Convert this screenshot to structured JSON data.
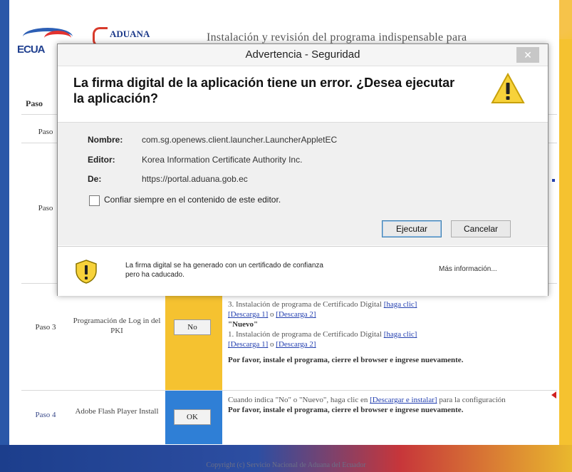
{
  "page": {
    "logo_ecua": "ECUA",
    "logo_aduana": "ADUANA",
    "title": "Instalación y revisión del programa indispensable para",
    "table_header_paso": "Paso",
    "rows": [
      {
        "paso": "Paso"
      },
      {
        "paso": "Paso"
      },
      {
        "paso": "Paso 3",
        "name": "Programación de Log in del PKI",
        "status": "No",
        "lines": [
          {
            "text": "3. Instalación de programa de Certificado Digital ",
            "link": "[haga clic]"
          },
          {
            "link": "[Descarga 1]",
            "text": " o ",
            "link2": "[Descarga 2]"
          },
          {
            "text": "\"Nuevo\""
          },
          {
            "text": "1. Instalación de programa de Certificado Digital ",
            "link": "[haga clic]"
          },
          {
            "link": "[Descarga 1]",
            "text": " o ",
            "link2": "[Descarga 2]"
          }
        ],
        "note": "Por favor, instale el programa, cierre el browser e ingrese nuevamente."
      },
      {
        "paso": "Paso 4",
        "name": "Adobe Flash Player Install",
        "status": "OK",
        "line1_pre": "Cuando indica \"No\" o \"Nuevo\", haga clic en ",
        "line1_link": "[Descargar e instalar]",
        "line1_post": " para la configuración",
        "note": "Por favor, instale el programa, cierre el browser e ingrese nuevamente."
      }
    ],
    "copyright": "Copyright (c) Servicio Nacional de Aduana del Ecuador"
  },
  "dialog": {
    "title": "Advertencia - Seguridad",
    "close_label": "✕",
    "heading": "La firma digital de la aplicación tiene un error.  ¿Desea ejecutar la aplicación?",
    "fields": [
      {
        "label": "Nombre:",
        "value": "com.sg.openews.client.launcher.LauncherAppletEC"
      },
      {
        "label": "Editor:",
        "value": "Korea Information Certificate Authority Inc."
      },
      {
        "label": "De:",
        "value": "https://portal.aduana.gob.ec"
      }
    ],
    "checkbox_label": "Confiar siempre en el contenido de este editor.",
    "run_button": "Ejecutar",
    "cancel_button": "Cancelar",
    "footer_text": "La firma digital se ha generado con un certificado de confianza pero ha caducado.",
    "more_info": "Más información..."
  },
  "colors": {
    "accent_yellow": "#f5c230",
    "accent_blue": "#2f7fd6",
    "frame_blue": "#2a57a8",
    "link_blue": "#2440b0"
  },
  "icons": [
    "warning-triangle-icon",
    "warning-shield-icon",
    "close-icon"
  ]
}
